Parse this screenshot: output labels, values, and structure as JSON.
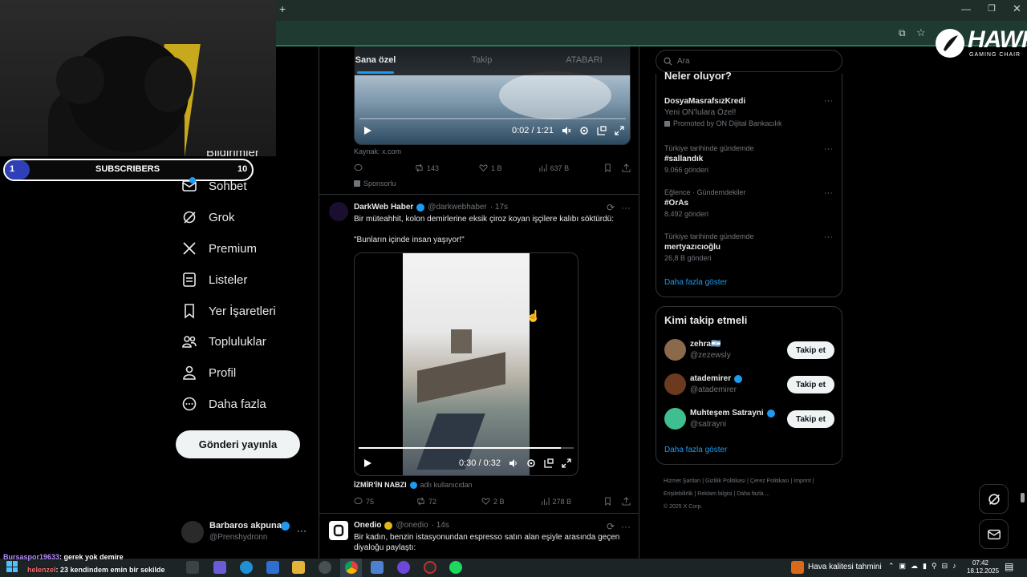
{
  "browser": {
    "new_tab": "+"
  },
  "overlay": {
    "logo_title": "HAWK",
    "logo_subtitle": "GAMING CHAIR",
    "subs_current": "1",
    "subs_label": "SUBSCRIBERS",
    "subs_goal": "10",
    "subs_progress": 0.1
  },
  "chat": [
    {
      "user": "Bursaspor19633",
      "text": ": gerek yok demire"
    },
    {
      "user": "helenzel",
      "text": ": 23 kendindem emin bir sekilde"
    }
  ],
  "sidebar": {
    "partial_item": "Bildirimler",
    "items": [
      {
        "label": "Sohbet",
        "icon": "mail-icon"
      },
      {
        "label": "Grok",
        "icon": "grok-icon"
      },
      {
        "label": "Premium",
        "icon": "x-icon"
      },
      {
        "label": "Listeler",
        "icon": "list-icon"
      },
      {
        "label": "Yer İşaretleri",
        "icon": "bookmark-icon"
      },
      {
        "label": "Topluluklar",
        "icon": "people-icon"
      },
      {
        "label": "Profil",
        "icon": "person-icon"
      },
      {
        "label": "Daha fazla",
        "icon": "more-icon"
      }
    ],
    "post_button": "Gönderi yayınla",
    "account_name": "Barbaros akpunar",
    "account_handle": "@Prenshydronn"
  },
  "tabs": [
    "Sana özel",
    "Takip",
    "ATABARI"
  ],
  "tweet1": {
    "time": "0:02 / 1:21",
    "source": "Kaynak: x.com",
    "retweets": "143",
    "likes": "1 B",
    "views": "637 B",
    "sponsored": "Sponsorlu"
  },
  "tweet2": {
    "name": "DarkWeb Haber",
    "handle": "@darkwebhaber",
    "time_ago": "· 17s",
    "text": "Bir müteahhit, kolon demirlerine eksik çiroz koyan işçilere kalıbı söktürdü:",
    "quote": "\"Bunların içinde insan yaşıyor!\"",
    "video_time": "0:30 / 0:32",
    "video_progress": 0.94,
    "credit_name": "İZMİR'İN NABZI",
    "credit_suffix": "adlı kullanıcıdan",
    "replies": "75",
    "retweets": "72",
    "likes": "2 B",
    "views": "278 B"
  },
  "tweet3": {
    "name": "Onedio",
    "handle": "@onedio",
    "time_ago": "· 14s",
    "text": "Bir kadın, benzin istasyonundan espresso satın alan eşiyle arasında geçen diyaloğu paylaştı:"
  },
  "search": {
    "placeholder": "Ara"
  },
  "trends": {
    "title": "Neler oluyor?",
    "items": [
      {
        "category": "",
        "name": "DosyaMasrafsızKredi",
        "sub": "Yeni ON'lulara Özel!",
        "count": "Promoted by ON Dijital Bankacılık"
      },
      {
        "category": "Türkiye tarihinde gündemde",
        "name": "#sallandık",
        "sub": "",
        "count": "9.066 gönderi"
      },
      {
        "category": "Eğlence · Gündemdekiler",
        "name": "#OrAs",
        "sub": "",
        "count": "8.492 gönderi"
      },
      {
        "category": "Türkiye tarihinde gündemde",
        "name": "mertyazıcıoğlu",
        "sub": "",
        "count": "26,8 B gönderi"
      }
    ],
    "more": "Daha fazla göster"
  },
  "who_to_follow": {
    "title": "Kimi takip etmeli",
    "items": [
      {
        "name": "zehra🇦🇷",
        "handle": "@zezewsly",
        "button": "Takip et"
      },
      {
        "name": "atademirer",
        "handle": "@atademirer",
        "button": "Takip et"
      },
      {
        "name": "Muhteşem Satrayni",
        "handle": "@satrayni",
        "button": "Takip et"
      }
    ],
    "more": "Daha fazla göster"
  },
  "footer": {
    "links": [
      "Hizmet Şartları",
      "Gizlilik Politikası",
      "Çerez Politikası",
      "Imprint",
      "Erişilebilirlik",
      "Reklam bilgisi",
      "Daha fazla ..."
    ],
    "copyright": "© 2025 X Corp."
  },
  "taskbar": {
    "weather": "Hava kalitesi tahmini",
    "time": "07:42",
    "date": "18.12.2025"
  },
  "colors": {
    "accent": "#1d9bf0",
    "bg": "#000000",
    "taskbar": "#1c2426",
    "chrome": "#1e3a31"
  }
}
